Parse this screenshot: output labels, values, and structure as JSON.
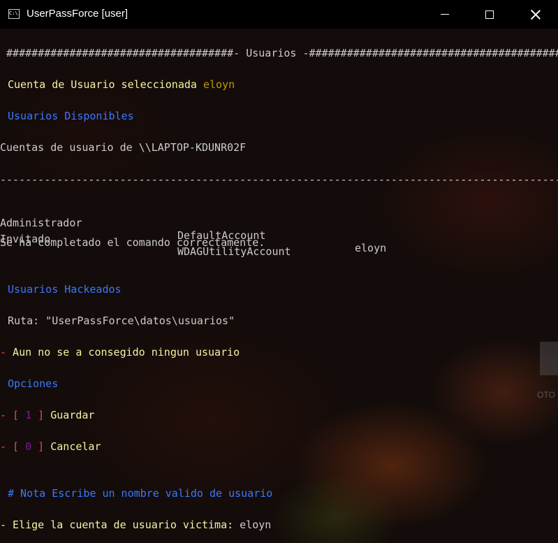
{
  "window": {
    "title": "UserPassForce [user]",
    "icon": "console-icon",
    "icon_text": "C:\\."
  },
  "console": {
    "header": {
      "hash_left": " ####################################",
      "label": "- Usuarios -",
      "hash_right": "##########################################"
    },
    "selected": {
      "label": "Cuenta de Usuario seleccionada ",
      "user": "eloyn"
    },
    "available_heading": "Usuarios Disponibles",
    "accounts_line": "Cuentas de usuario de \\\\LAPTOP-KDUNR02F",
    "separator": "------------------------------------------------------------------------------------------------",
    "users": [
      [
        "Administrador",
        "DefaultAccount",
        "eloyn"
      ],
      [
        "Invitado",
        "WDAGUtilityAccount",
        ""
      ]
    ],
    "command_ok": "Se ha completado el comando correctamente.",
    "hacked_heading": "Usuarios Hackeados",
    "route": "Ruta: \"UserPassForce\\datos\\usuarios\"",
    "no_user": {
      "dash": "-",
      "text": " Aun no se a consegido ningun usuario"
    },
    "options_heading": "Opciones",
    "options": [
      {
        "dash": "-",
        "bracket_open": " [ ",
        "key": "1",
        "bracket_close": " ]",
        "label": " Guardar"
      },
      {
        "dash": "-",
        "bracket_open": " [ ",
        "key": "0",
        "bracket_close": " ]",
        "label": " Cancelar"
      }
    ],
    "note": "# Nota Escribe un nombre valido de usuario",
    "prompt": {
      "text": "- Elige la cuenta de usuario victima: ",
      "value": "eloyn"
    }
  },
  "side_widget_label": "OTO",
  "colors": {
    "white": "#cccccc",
    "yellow": "#f9f1a5",
    "gold": "#c19c00",
    "blue": "#3b78ff",
    "red": "#e74856",
    "magenta": "#881798"
  }
}
